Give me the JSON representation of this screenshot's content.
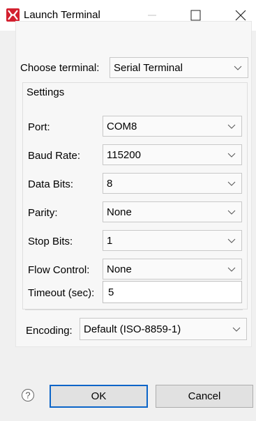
{
  "window": {
    "title": "Launch Terminal",
    "icon": "app-logo-icon",
    "controls": [
      "minimize-icon",
      "maximize-icon",
      "close-icon"
    ]
  },
  "terminal": {
    "label": "Choose terminal:",
    "value": "Serial Terminal"
  },
  "settings": {
    "group_title": "Settings",
    "port": {
      "label": "Port:",
      "value": "COM8"
    },
    "baud_rate": {
      "label": "Baud Rate:",
      "value": "115200"
    },
    "data_bits": {
      "label": "Data Bits:",
      "value": "8"
    },
    "parity": {
      "label": "Parity:",
      "value": "None"
    },
    "stop_bits": {
      "label": "Stop Bits:",
      "value": "1"
    },
    "flow_control": {
      "label": "Flow Control:",
      "value": "None"
    },
    "timeout": {
      "label": "Timeout (sec):",
      "value": "5"
    }
  },
  "encoding": {
    "label": "Encoding:",
    "value": "Default (ISO-8859-1)"
  },
  "buttons": {
    "help_icon": "help-icon",
    "ok": "OK",
    "cancel": "Cancel"
  },
  "colors": {
    "brand": "#d3202f",
    "default_button_border": "#0a64c8"
  }
}
